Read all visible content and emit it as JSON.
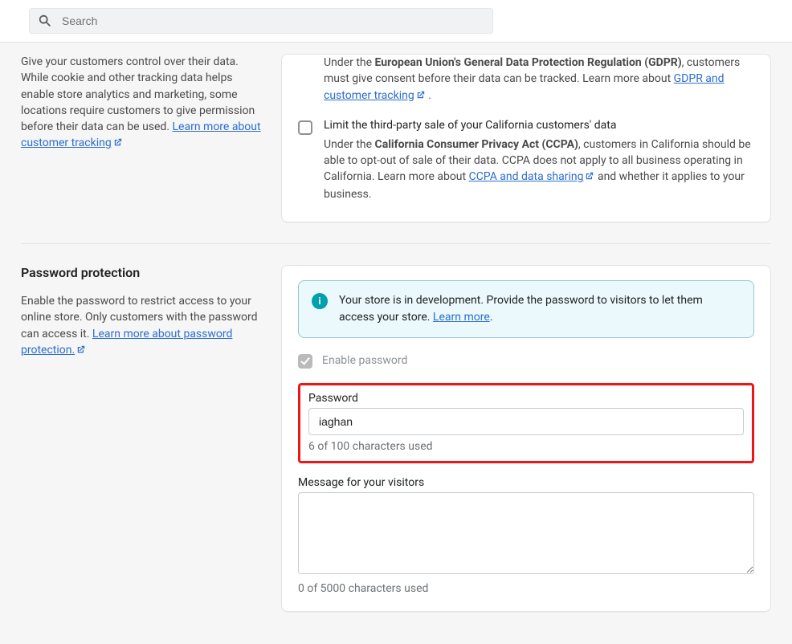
{
  "header": {
    "search_placeholder": "Search"
  },
  "tracking_section": {
    "description": "Give your customers control over their data. While cookie and other tracking data helps enable store analytics and marketing, some locations require customers to give permission before their data can be used.",
    "learn_more_label": "Learn more about customer tracking",
    "gdpr": {
      "text_before_bold": "Under the ",
      "bold": "European Union's General Data Protection Regulation (GDPR)",
      "text_after_bold": ", customers must give consent before their data can be tracked. Learn more about ",
      "link": "GDPR and customer tracking"
    },
    "ccpa": {
      "title": "Limit the third-party sale of your California customers' data",
      "text_before_bold": "Under the ",
      "bold": "California Consumer Privacy Act (CCPA)",
      "text_after_bold": ", customers in California should be able to opt-out of sale of their data. CCPA does not apply to all business operating in California. Learn more about ",
      "link": "CCPA and data sharing",
      "trailing": " and whether it applies to your business."
    }
  },
  "password_section": {
    "heading": "Password protection",
    "desc_before_link": "Enable the password to restrict access to your online store. Only customers with the password can access it. ",
    "learn_more_label": "Learn more about password protection.",
    "banner_text": "Your store is in development. Provide the password to visitors to let them access your store. ",
    "banner_link": "Learn more",
    "enable_label": "Enable password",
    "password_label": "Password",
    "password_value": "iaghan",
    "password_counter": "6 of 100 characters used",
    "message_label": "Message for your visitors",
    "message_value": "",
    "message_counter": "0 of 5000 characters used"
  }
}
